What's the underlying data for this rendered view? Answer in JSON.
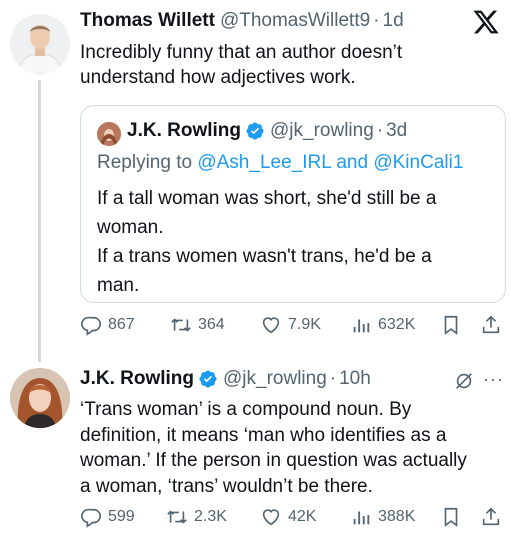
{
  "tweet1": {
    "name": "Thomas Willett",
    "handle": "@ThomasWillett9",
    "dot": "·",
    "time": "1d",
    "text_lines": [
      "Incredibly funny that an author doesn’t",
      "understand how adjectives work."
    ],
    "quote": {
      "name": "J.K. Rowling",
      "handle": "@jk_rowling",
      "dot": "·",
      "time": "3d",
      "replying_prefix": "Replying to ",
      "replying_user1": "@Ash_Lee_IRL",
      "replying_and": " and ",
      "replying_user2": "@KinCali1",
      "text_lines": [
        "If a tall woman was short, she'd still be a",
        "woman.",
        "If a trans women wasn't trans, he'd be a",
        "man."
      ]
    },
    "actions": {
      "replies": "867",
      "reposts": "364",
      "likes": "7.9K",
      "views": "632K"
    }
  },
  "tweet2": {
    "name": "J.K. Rowling",
    "handle": "@jk_rowling",
    "dot": "·",
    "time": "10h",
    "text_lines": [
      "‘Trans woman’ is a compound noun. By",
      "definition, it means ‘man who identifies as a",
      "woman.’ If the person in question was actually",
      "a woman, ‘trans’ wouldn’t be there."
    ],
    "actions": {
      "replies": "599",
      "reposts": "2.3K",
      "likes": "42K",
      "views": "388K"
    }
  },
  "more_glyph": "···",
  "colors": {
    "text": "#0f1419",
    "secondary": "#536471",
    "link": "#1d9bf0",
    "border": "#cfd9de"
  },
  "icons": [
    "x-logo-icon",
    "verified-badge-icon",
    "reply-icon",
    "repost-icon",
    "like-icon",
    "views-icon",
    "bookmark-icon",
    "share-icon",
    "grok-icon",
    "more-icon"
  ]
}
